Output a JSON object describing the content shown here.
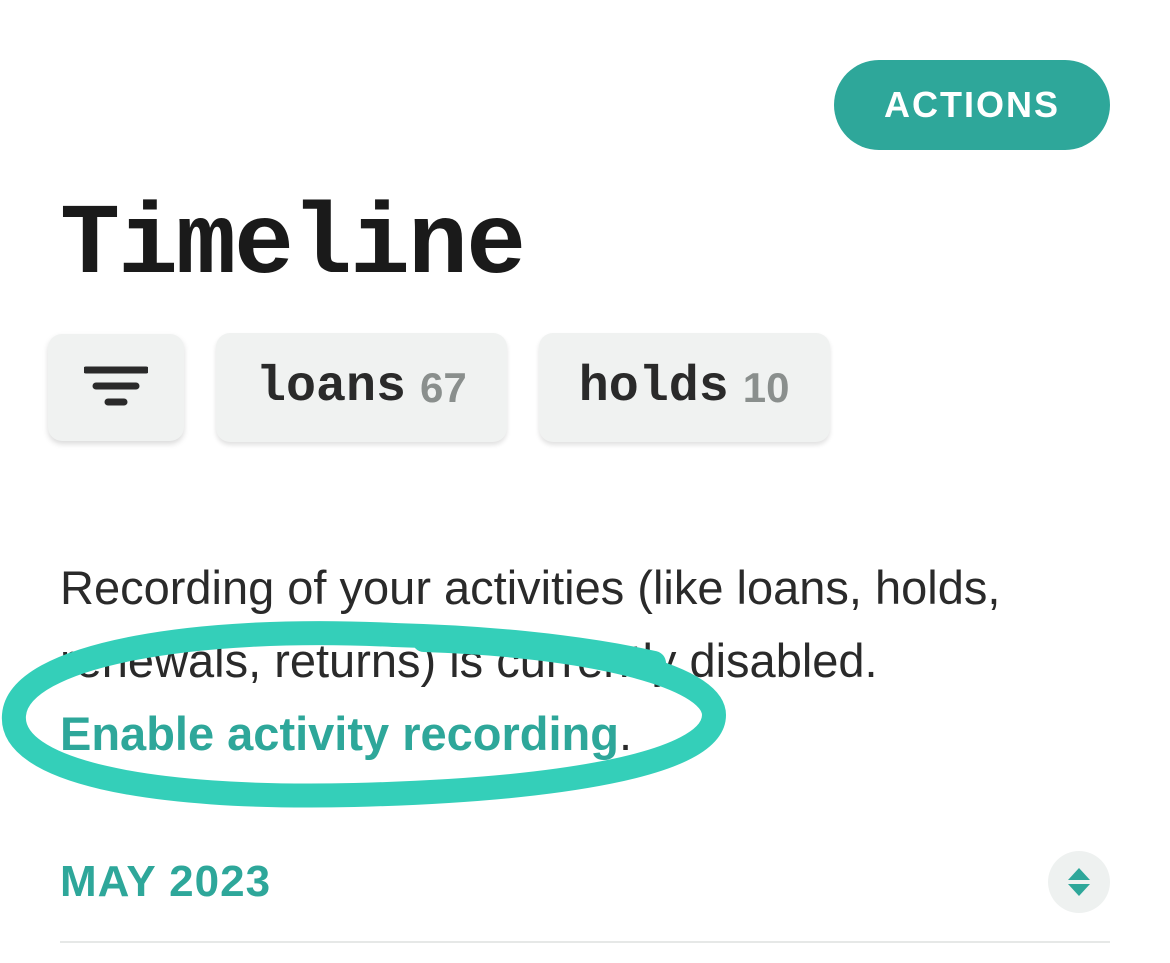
{
  "header": {
    "actions_label": "ACTIONS"
  },
  "title": "Timeline",
  "filters": {
    "loans": {
      "label": "loans",
      "count": "67"
    },
    "holds": {
      "label": "holds",
      "count": "10"
    }
  },
  "info": {
    "text": "Recording of your activities (like loans, holds, renewals, returns) is currently disabled.",
    "link_label": "Enable activity recording",
    "suffix": "."
  },
  "month": {
    "label": "MAY 2023"
  },
  "colors": {
    "accent": "#2ea79a",
    "filter_bg": "#f0f2f1",
    "text_muted": "#8a8f8d"
  }
}
